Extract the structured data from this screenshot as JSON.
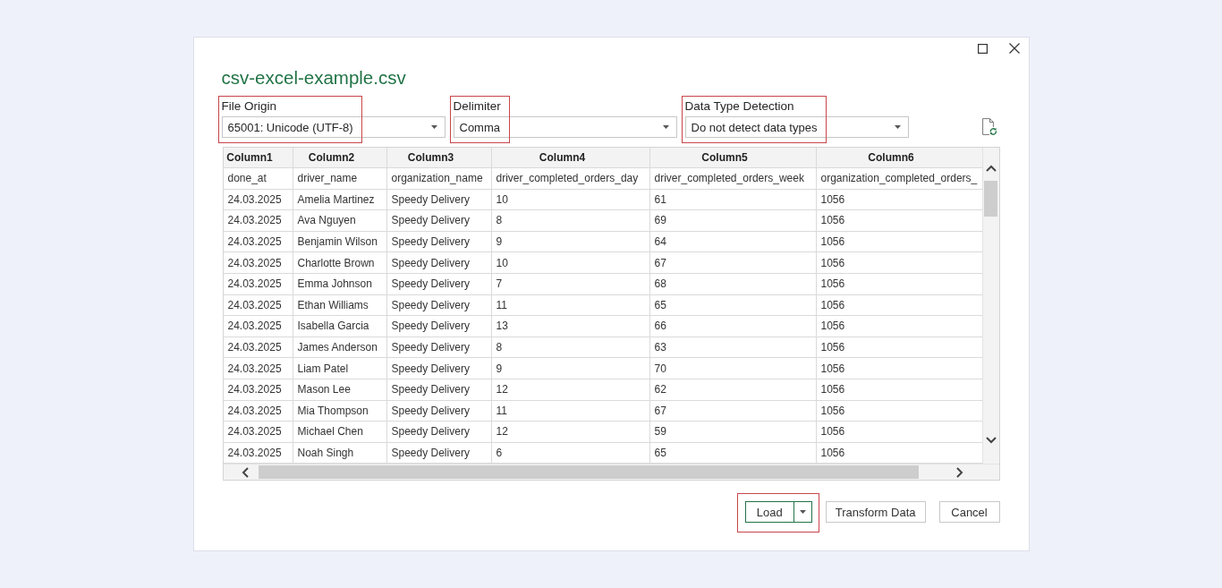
{
  "window": {
    "title": "csv-excel-example.csv"
  },
  "options": [
    {
      "label": "File Origin",
      "value": "65001: Unicode (UTF-8)",
      "highlighted": true
    },
    {
      "label": "Delimiter",
      "value": "Comma",
      "highlighted": true
    },
    {
      "label": "Data Type Detection",
      "value": "Do not detect data types",
      "highlighted": true
    }
  ],
  "preview": {
    "columns": [
      "Column1",
      "Column2",
      "Column3",
      "Column4",
      "Column5",
      "Column6"
    ],
    "rows": [
      [
        "done_at",
        "driver_name",
        "organization_name",
        "driver_completed_orders_day",
        "driver_completed_orders_week",
        "organization_completed_orders_"
      ],
      [
        "24.03.2025",
        "Amelia Martinez",
        "Speedy Delivery",
        "10",
        "61",
        "1056"
      ],
      [
        "24.03.2025",
        "Ava Nguyen",
        "Speedy Delivery",
        "8",
        "69",
        "1056"
      ],
      [
        "24.03.2025",
        "Benjamin Wilson",
        "Speedy Delivery",
        "9",
        "64",
        "1056"
      ],
      [
        "24.03.2025",
        "Charlotte Brown",
        "Speedy Delivery",
        "10",
        "67",
        "1056"
      ],
      [
        "24.03.2025",
        "Emma Johnson",
        "Speedy Delivery",
        "7",
        "68",
        "1056"
      ],
      [
        "24.03.2025",
        "Ethan Williams",
        "Speedy Delivery",
        "11",
        "65",
        "1056"
      ],
      [
        "24.03.2025",
        "Isabella Garcia",
        "Speedy Delivery",
        "13",
        "66",
        "1056"
      ],
      [
        "24.03.2025",
        "James Anderson",
        "Speedy Delivery",
        "8",
        "63",
        "1056"
      ],
      [
        "24.03.2025",
        "Liam Patel",
        "Speedy Delivery",
        "9",
        "70",
        "1056"
      ],
      [
        "24.03.2025",
        "Mason Lee",
        "Speedy Delivery",
        "12",
        "62",
        "1056"
      ],
      [
        "24.03.2025",
        "Mia Thompson",
        "Speedy Delivery",
        "11",
        "67",
        "1056"
      ],
      [
        "24.03.2025",
        "Michael Chen",
        "Speedy Delivery",
        "12",
        "59",
        "1056"
      ],
      [
        "24.03.2025",
        "Noah Singh",
        "Speedy Delivery",
        "6",
        "65",
        "1056"
      ]
    ]
  },
  "buttons": [
    {
      "label": "Load",
      "kind": "split",
      "default": true,
      "highlighted": true
    },
    {
      "label": "Transform Data",
      "kind": "plain",
      "default": false,
      "highlighted": false
    },
    {
      "label": "Cancel",
      "kind": "plain",
      "default": false,
      "highlighted": false
    }
  ]
}
